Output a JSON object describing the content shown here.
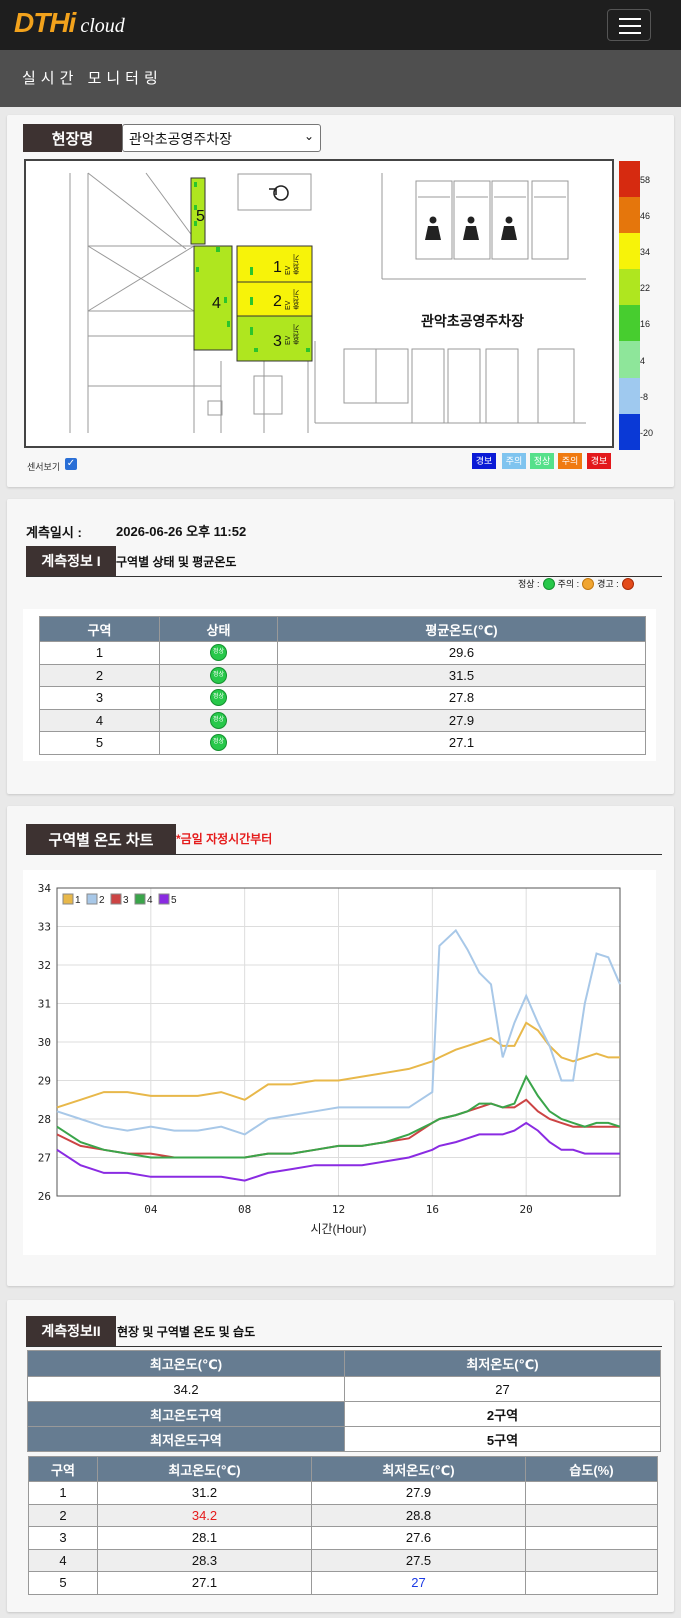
{
  "app": {
    "logo_main": "DTHi",
    "logo_sub": "cloud",
    "menu_icon": "hamburger-icon",
    "page_title": "실시간 모니터링"
  },
  "site": {
    "label": "현장명",
    "selected": "관악초공영주차장",
    "map_title": "관악초공영주차장",
    "zones": [
      "1",
      "2",
      "3",
      "4",
      "5"
    ],
    "ev_label": "EV\n충전기",
    "sensor_toggle": "센서보기",
    "scale": {
      "values": [
        "58",
        "46",
        "34",
        "22",
        "16",
        "4",
        "-8",
        "-20"
      ],
      "colors": [
        "#d62a10",
        "#e5760c",
        "#f7f309",
        "#afe61f",
        "#47cd2f",
        "#8ee69a",
        "#9fc9ef",
        "#0a39d6"
      ]
    },
    "legend": [
      {
        "label": "경보",
        "color": "#0a1ad6"
      },
      {
        "label": "주의",
        "color": "#7fc4ef"
      },
      {
        "label": "정상",
        "color": "#55e08a"
      },
      {
        "label": "주의",
        "color": "#f07a10"
      },
      {
        "label": "경보",
        "color": "#e3181b"
      }
    ]
  },
  "info1": {
    "timestamp_label": "계측일시 :",
    "timestamp_value": "2026-06-26 오후 11:52",
    "section_label": "계측정보 I",
    "section_title": "구역별 상태 및 평균온도",
    "legend": {
      "normal": "정상 :",
      "caution": "주의 :",
      "warning": "경고 :"
    },
    "headers": [
      "구역",
      "상태",
      "평균온도(℃)"
    ],
    "rows": [
      {
        "zone": "1",
        "status": "정상",
        "avg": "29.6"
      },
      {
        "zone": "2",
        "status": "정상",
        "avg": "31.5"
      },
      {
        "zone": "3",
        "status": "정상",
        "avg": "27.8"
      },
      {
        "zone": "4",
        "status": "정상",
        "avg": "27.9"
      },
      {
        "zone": "5",
        "status": "정상",
        "avg": "27.1"
      }
    ]
  },
  "chart_section": {
    "label": "구역별 온도 차트",
    "note": "*금일 자정시간부터"
  },
  "chart_data": {
    "type": "line",
    "title": "",
    "xlabel": "시간(Hour)",
    "ylabel": "",
    "xlim": [
      0,
      24
    ],
    "ylim": [
      26,
      34
    ],
    "xticks": [
      "04",
      "08",
      "12",
      "16",
      "20"
    ],
    "yticks": [
      "26",
      "27",
      "28",
      "29",
      "30",
      "31",
      "32",
      "33",
      "34"
    ],
    "grid": true,
    "legend_position": "top-left",
    "x": [
      0,
      1,
      2,
      3,
      4,
      5,
      6,
      7,
      8,
      9,
      10,
      11,
      12,
      13,
      14,
      15,
      16,
      16.3,
      17,
      17.5,
      18,
      18.5,
      19,
      19.5,
      20,
      20.5,
      21,
      21.5,
      22,
      22.5,
      23,
      23.5,
      24
    ],
    "series": [
      {
        "name": "1",
        "color": "#e8b84a",
        "values": [
          28.3,
          28.5,
          28.7,
          28.7,
          28.6,
          28.6,
          28.6,
          28.7,
          28.5,
          28.9,
          28.9,
          29.0,
          29.0,
          29.1,
          29.2,
          29.3,
          29.5,
          29.6,
          29.8,
          29.9,
          30.0,
          30.1,
          29.9,
          29.9,
          30.5,
          30.3,
          29.9,
          29.6,
          29.5,
          29.6,
          29.7,
          29.6,
          29.6
        ]
      },
      {
        "name": "2",
        "color": "#a8c8e8",
        "values": [
          28.2,
          28.0,
          27.8,
          27.7,
          27.8,
          27.7,
          27.7,
          27.8,
          27.6,
          28.0,
          28.1,
          28.2,
          28.3,
          28.3,
          28.3,
          28.3,
          28.7,
          32.5,
          32.9,
          32.4,
          31.8,
          31.5,
          29.6,
          30.5,
          31.2,
          30.5,
          29.9,
          29.0,
          29.0,
          31.0,
          32.3,
          32.2,
          31.5
        ]
      },
      {
        "name": "3",
        "color": "#cc4444",
        "values": [
          27.6,
          27.3,
          27.2,
          27.1,
          27.1,
          27.0,
          27.0,
          27.0,
          27.0,
          27.1,
          27.1,
          27.2,
          27.3,
          27.3,
          27.4,
          27.5,
          27.9,
          28.0,
          28.1,
          28.2,
          28.3,
          28.4,
          28.3,
          28.3,
          28.5,
          28.2,
          28.0,
          27.9,
          27.8,
          27.8,
          27.8,
          27.8,
          27.8
        ]
      },
      {
        "name": "4",
        "color": "#3aa54a",
        "values": [
          27.8,
          27.4,
          27.2,
          27.1,
          27.0,
          27.0,
          27.0,
          27.0,
          27.0,
          27.1,
          27.1,
          27.2,
          27.3,
          27.3,
          27.4,
          27.6,
          27.9,
          28.0,
          28.1,
          28.2,
          28.4,
          28.4,
          28.3,
          28.4,
          29.1,
          28.6,
          28.2,
          28.0,
          27.9,
          27.8,
          27.9,
          27.9,
          27.8
        ]
      },
      {
        "name": "5",
        "color": "#8a2be2",
        "values": [
          27.2,
          26.8,
          26.6,
          26.6,
          26.5,
          26.5,
          26.5,
          26.5,
          26.4,
          26.6,
          26.7,
          26.8,
          26.8,
          26.8,
          26.9,
          27.0,
          27.2,
          27.3,
          27.4,
          27.5,
          27.6,
          27.6,
          27.6,
          27.7,
          27.9,
          27.7,
          27.4,
          27.2,
          27.2,
          27.1,
          27.1,
          27.1,
          27.1
        ]
      }
    ]
  },
  "info2": {
    "section_label": "계측정보II",
    "section_title": "현장 및 구역별 온도 및 습도",
    "max_label": "최고온도(℃)",
    "min_label": "최저온도(℃)",
    "max_value": "34.2",
    "min_value": "27",
    "max_zone_label": "최고온도구역",
    "max_zone_value": "2구역",
    "min_zone_label": "최저온도구역",
    "min_zone_value": "5구역",
    "headers": [
      "구역",
      "최고온도(℃)",
      "최저온도(℃)",
      "습도(%)"
    ],
    "rows": [
      {
        "zone": "1",
        "max": "31.2",
        "min": "27.9",
        "hum": ""
      },
      {
        "zone": "2",
        "max": "34.2",
        "min": "28.8",
        "hum": ""
      },
      {
        "zone": "3",
        "max": "28.1",
        "min": "27.6",
        "hum": ""
      },
      {
        "zone": "4",
        "max": "28.3",
        "min": "27.5",
        "hum": ""
      },
      {
        "zone": "5",
        "max": "27.1",
        "min": "27",
        "hum": ""
      }
    ],
    "highlight": {
      "max_color": "#e51c1c",
      "min_color": "#1c3ae5"
    }
  }
}
